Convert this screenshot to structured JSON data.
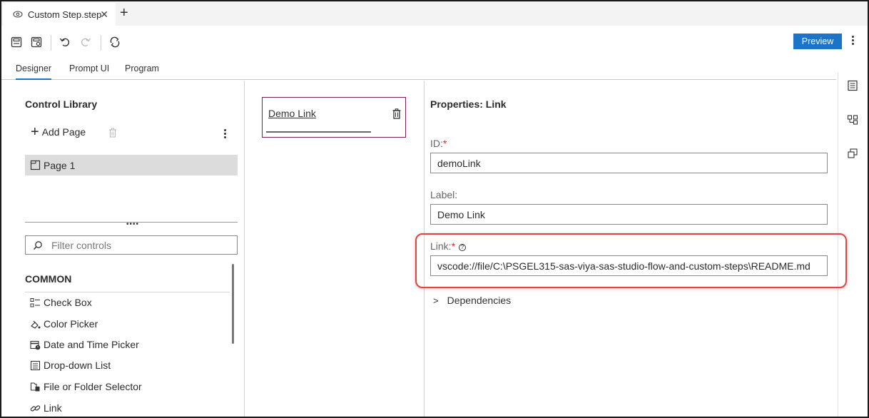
{
  "document_tab": {
    "title": "Custom Step.step",
    "close_glyph": "✕"
  },
  "add_tab_glyph": "+",
  "toolbar": {
    "preview_label": "Preview",
    "icons": [
      "save-icon",
      "save-as-icon",
      "undo-icon",
      "redo-icon",
      "refresh-icon",
      "more-options-icon"
    ]
  },
  "view_tabs": [
    {
      "label": "Designer",
      "active": true
    },
    {
      "label": "Prompt UI",
      "active": false
    },
    {
      "label": "Program",
      "active": false
    }
  ],
  "control_library": {
    "title": "Control Library",
    "add_page_label": "Add Page",
    "pages": [
      "Page 1"
    ],
    "filter_placeholder": "Filter controls",
    "section_title": "COMMON",
    "controls": [
      {
        "label": "Check Box",
        "icon": "check-box-icon"
      },
      {
        "label": "Color Picker",
        "icon": "color-picker-icon"
      },
      {
        "label": "Date and Time Picker",
        "icon": "calendar-icon"
      },
      {
        "label": "Drop-down List",
        "icon": "drop-down-list-icon"
      },
      {
        "label": "File or Folder Selector",
        "icon": "file-selector-icon"
      },
      {
        "label": "Link",
        "icon": "link-icon"
      }
    ]
  },
  "canvas": {
    "link_text": "Demo Link"
  },
  "properties": {
    "title": "Properties: Link",
    "id_label": "ID:",
    "id_value": "demoLink",
    "label_label": "Label:",
    "label_value": "Demo Link",
    "link_label": "Link:",
    "link_value": "vscode://file/C:\\PSGEL315-sas-viya-sas-studio-flow-and-custom-steps\\README.md",
    "required_mark": "*",
    "help_glyph": "?",
    "dependencies_label": "Dependencies"
  },
  "colors": {
    "accent": "#1b74c7",
    "highlight": "#e04545",
    "selected_card_border": "#7a1f5c"
  }
}
